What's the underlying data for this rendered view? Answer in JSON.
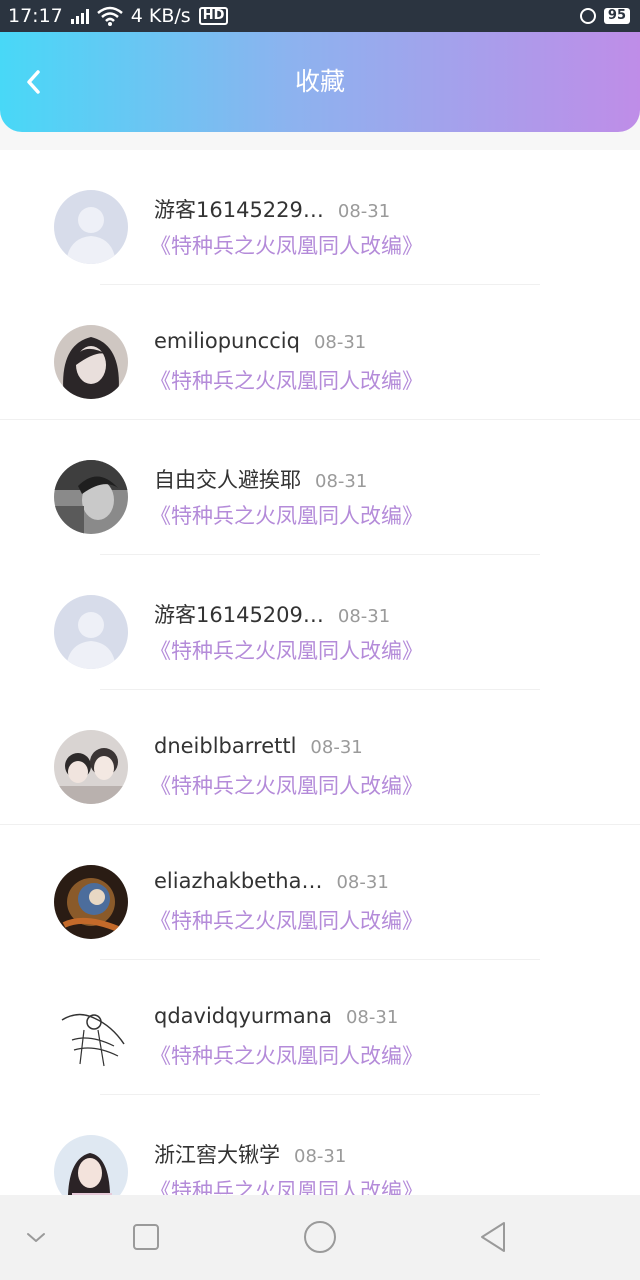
{
  "status_bar": {
    "time": "17:17",
    "network_tag": "4G",
    "net_speed": "4 KB/s",
    "hd_label": "HD",
    "battery": "95"
  },
  "header": {
    "title": "收藏",
    "back_icon": "chevron-left-icon",
    "gradient_colors": [
      "#48d8f7",
      "#bf8de8"
    ]
  },
  "items": [
    {
      "name": "游客16145229…",
      "date": "08-31",
      "book": "《特种兵之火凤凰同人改编》",
      "avatar": "default-avatar"
    },
    {
      "name": "emiliopuncciq",
      "date": "08-31",
      "book": "《特种兵之火凤凰同人改编》",
      "avatar": "photo-avatar"
    },
    {
      "name": "自由交人避挨耶",
      "date": "08-31",
      "book": "《特种兵之火凤凰同人改编》",
      "avatar": "photo-avatar"
    },
    {
      "name": "游客16145209…",
      "date": "08-31",
      "book": "《特种兵之火凤凰同人改编》",
      "avatar": "default-avatar"
    },
    {
      "name": "dneiblbarrettl",
      "date": "08-31",
      "book": "《特种兵之火凤凰同人改编》",
      "avatar": "photo-avatar"
    },
    {
      "name": "eliazhakbetha…",
      "date": "08-31",
      "book": "《特种兵之火凤凰同人改编》",
      "avatar": "photo-avatar"
    },
    {
      "name": "qdavidqyurmana",
      "date": "08-31",
      "book": "《特种兵之火凤凰同人改编》",
      "avatar": "sketch-avatar"
    },
    {
      "name": "浙江窖大锹学",
      "date": "08-31",
      "book": "《特种兵之火凤凰同人改编》",
      "avatar": "photo-avatar"
    }
  ],
  "colors": {
    "book_title": "#b48bd9",
    "date": "#9a9a9a",
    "name": "#333333"
  },
  "nav_bar": {
    "icons": [
      "chevron-down-icon",
      "square-icon",
      "circle-icon",
      "triangle-back-icon"
    ]
  }
}
